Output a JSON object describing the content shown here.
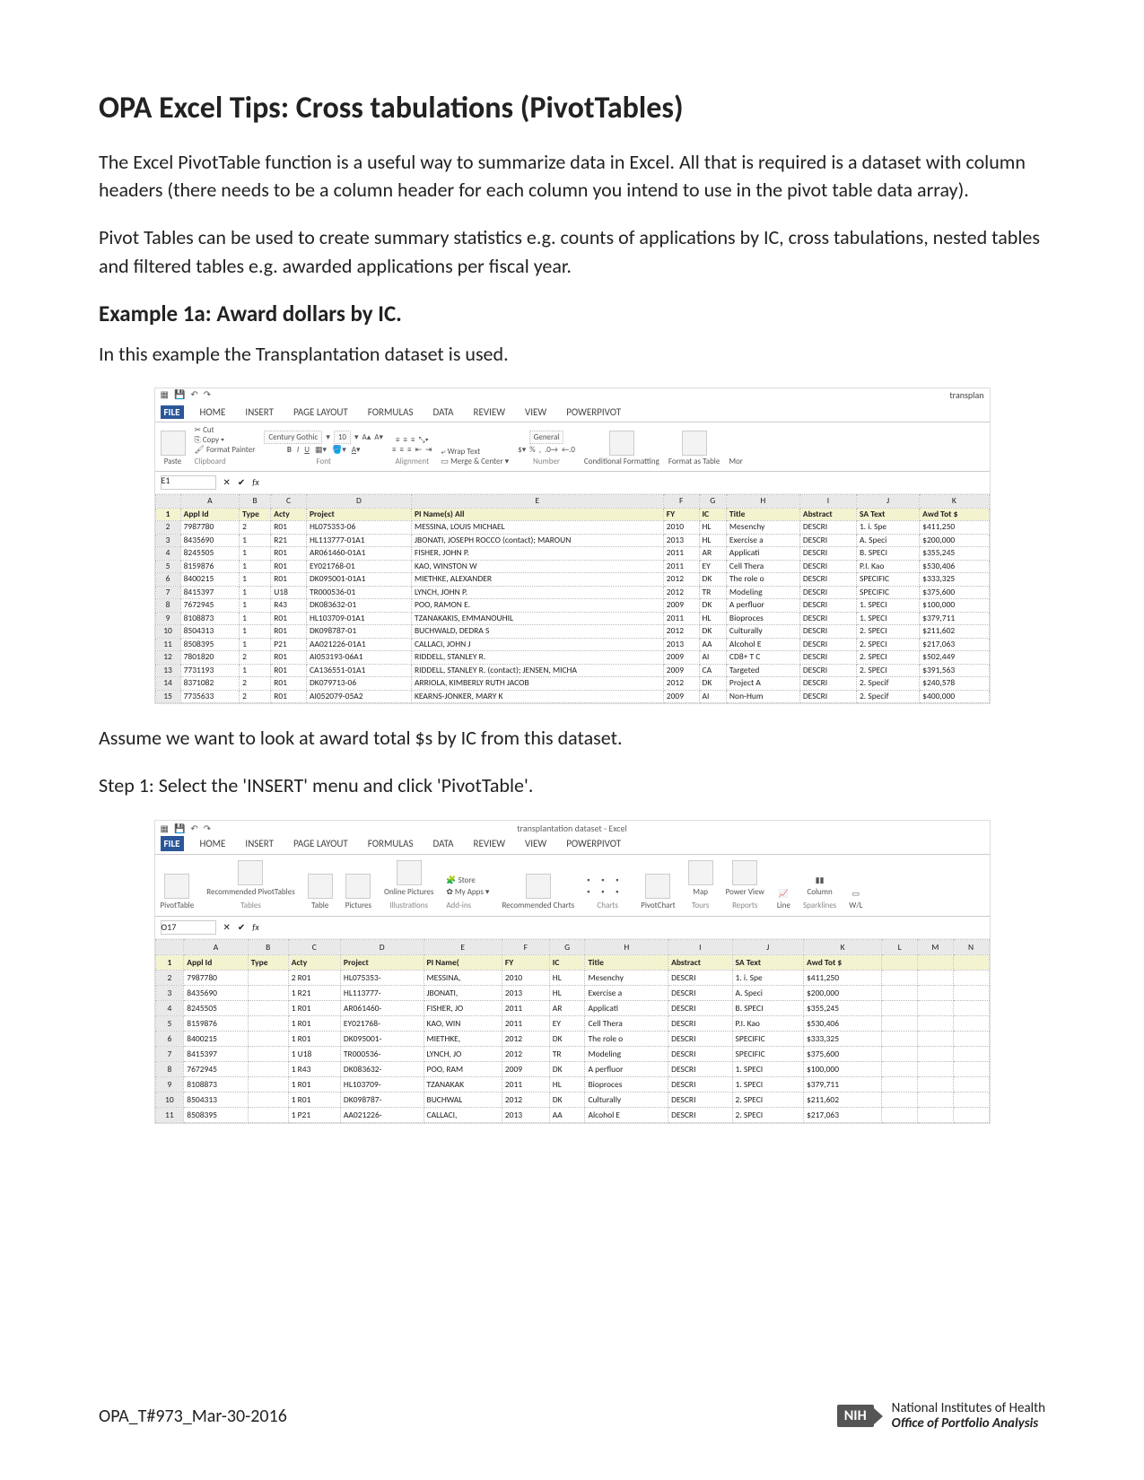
{
  "title": "OPA Excel Tips: Cross tabulations (PivotTables)",
  "para1": "The Excel PivotTable function is a useful way to summarize data in Excel.  All that is required is a dataset with column headers (there needs to be a column header for each column you intend to use in the pivot table data array).",
  "para2": "Pivot Tables can be used to create summary statistics e.g. counts of applications by IC, cross tabulations, nested tables and filtered tables e.g. awarded applications per fiscal year.",
  "example_heading": "Example 1a: Award dollars by IC.",
  "example_intro": "In this example the Transplantation dataset is used.",
  "assume_line": "Assume we want to look at award total $s by IC from this dataset.",
  "step1": "Step 1: Select the 'INSERT' menu and click 'PivotTable'.",
  "footer_id": "OPA_T#973_Mar-30-2016",
  "footer_org1": "National Institutes of Health",
  "footer_org2": "Office of Portfolio Analysis",
  "nih": "NIH",
  "ribbon_tabs": [
    "FILE",
    "HOME",
    "INSERT",
    "PAGE LAYOUT",
    "FORMULAS",
    "DATA",
    "REVIEW",
    "VIEW",
    "POWERPIVOT"
  ],
  "shot1": {
    "titlebar": "transplan",
    "clip": {
      "cut": "Cut",
      "copy": "Copy",
      "fmt": "Format Painter",
      "paste": "Paste",
      "group": "Clipboard"
    },
    "font": {
      "name": "Century Gothic",
      "size": "10",
      "group": "Font"
    },
    "align": {
      "wrap": "Wrap Text",
      "merge": "Merge & Center",
      "group": "Alignment"
    },
    "number": {
      "fmt": "General",
      "group": "Number"
    },
    "styles": {
      "cond": "Conditional Formatting",
      "fmtas": "Format as Table",
      "more": "Mor"
    },
    "cellref": "E1",
    "cols": [
      "",
      "A",
      "B",
      "C",
      "D",
      "E",
      "F",
      "G",
      "H",
      "I",
      "J",
      "K"
    ],
    "header_row": [
      "1",
      "Appl Id",
      "Type",
      "Acty",
      "Project",
      "PI Name(s) All",
      "FY",
      "IC",
      "Title",
      "Abstract",
      "SA Text",
      "Awd Tot $"
    ],
    "rows": [
      [
        "2",
        "7987780",
        "2",
        "R01",
        "HL075353-06",
        "MESSINA, LOUIS MICHAEL",
        "2010",
        "HL",
        "Mesenchy",
        "DESCRI",
        "1. i. Spe",
        "$411,250"
      ],
      [
        "3",
        "8435690",
        "1",
        "R21",
        "HL113777-01A1",
        "JBONATI, JOSEPH ROCCO (contact); MAROUN",
        "2013",
        "HL",
        "Exercise a",
        "DESCRI",
        "A. Speci",
        "$200,000"
      ],
      [
        "4",
        "8245505",
        "1",
        "R01",
        "AR061460-01A1",
        "FISHER, JOHN P.",
        "2011",
        "AR",
        "Applicati",
        "DESCRI",
        "B. SPECI",
        "$355,245"
      ],
      [
        "5",
        "8159876",
        "1",
        "R01",
        "EY021768-01",
        "KAO, WINSTON W",
        "2011",
        "EY",
        "Cell Thera",
        "DESCRI",
        "P.I. Kao",
        "$530,406"
      ],
      [
        "6",
        "8400215",
        "1",
        "R01",
        "DK095001-01A1",
        "MIETHKE, ALEXANDER",
        "2012",
        "DK",
        "The role o",
        "DESCRI",
        "SPECIFIC",
        "$333,325"
      ],
      [
        "7",
        "8415397",
        "1",
        "U18",
        "TR000536-01",
        "LYNCH, JOHN P.",
        "2012",
        "TR",
        "Modeling",
        "DESCRI",
        "SPECIFIC",
        "$375,600"
      ],
      [
        "8",
        "7672945",
        "1",
        "R43",
        "DK083632-01",
        "POO, RAMON E.",
        "2009",
        "DK",
        "A perfluor",
        "DESCRI",
        "1. SPECI",
        "$100,000"
      ],
      [
        "9",
        "8108873",
        "1",
        "R01",
        "HL103709-01A1",
        "TZANAKAKIS, EMMANOUHIL",
        "2011",
        "HL",
        "Bioproces",
        "DESCRI",
        "1. SPECI",
        "$379,711"
      ],
      [
        "10",
        "8504313",
        "1",
        "R01",
        "DK098787-01",
        "BUCHWALD, DEDRA S",
        "2012",
        "DK",
        "Culturally",
        "DESCRI",
        "2. SPECI",
        "$211,602"
      ],
      [
        "11",
        "8508395",
        "1",
        "P21",
        "AA021226-01A1",
        "CALLACI, JOHN J",
        "2013",
        "AA",
        "Alcohol E",
        "DESCRI",
        "2. SPECI",
        "$217,063"
      ],
      [
        "12",
        "7801820",
        "2",
        "R01",
        "AI053193-06A1",
        "RIDDELL, STANLEY R.",
        "2009",
        "AI",
        "CD8+ T C",
        "DESCRI",
        "2. SPECI",
        "$502,449"
      ],
      [
        "13",
        "7731193",
        "1",
        "R01",
        "CA136551-01A1",
        "RIDDELL, STANLEY R. (contact); JENSEN, MICHA",
        "2009",
        "CA",
        "Targeted",
        "DESCRI",
        "2. SPECI",
        "$391,563"
      ],
      [
        "14",
        "8371082",
        "2",
        "R01",
        "DK079713-06",
        "ARRIOLA, KIMBERLY RUTH JACOB",
        "2012",
        "DK",
        "Project A",
        "DESCRI",
        "2. Specif",
        "$240,578"
      ],
      [
        "15",
        "7735633",
        "2",
        "R01",
        "AI052079-05A2",
        "KEARNS-JONKER, MARY K",
        "2009",
        "AI",
        "Non-Hum",
        "DESCRI",
        "2. Specif",
        "$400,000"
      ]
    ]
  },
  "shot2": {
    "titlebar": "transplantation dataset - Excel",
    "insert": {
      "pivot": "PivotTable",
      "recpivot": "Recommended PivotTables",
      "table": "Table",
      "group1": "Tables",
      "pics": "Pictures",
      "online": "Online Pictures",
      "group2": "Illustrations",
      "store": "Store",
      "myapps": "My Apps",
      "group3": "Add-ins",
      "reccharts": "Recommended Charts",
      "group4": "Charts",
      "pivotchart": "PivotChart",
      "map": "Map",
      "power": "Power View",
      "group5": "Tours",
      "line": "Line",
      "col": "Column",
      "wl": "W/L",
      "group6": "Sparklines",
      "reports": "Reports"
    },
    "cellref": "O17",
    "cols": [
      "",
      "A",
      "B",
      "C",
      "D",
      "E",
      "F",
      "G",
      "H",
      "I",
      "J",
      "K",
      "L",
      "M",
      "N"
    ],
    "header_row": [
      "1",
      "Appl Id",
      "Type",
      "Acty",
      "Project",
      "PI Name(",
      "FY",
      "IC",
      "Title",
      "Abstract",
      "SA Text",
      "Awd Tot $",
      "",
      "",
      ""
    ],
    "rows": [
      [
        "2",
        "7987780",
        "",
        "2 R01",
        "HL075353-",
        "MESSINA,",
        "2010",
        "HL",
        "Mesenchy",
        "DESCRI",
        "1. i. Spe",
        "$411,250",
        "",
        "",
        ""
      ],
      [
        "3",
        "8435690",
        "",
        "1 R21",
        "HL113777-",
        "JBONATI,",
        "2013",
        "HL",
        "Exercise a",
        "DESCRI",
        "A. Speci",
        "$200,000",
        "",
        "",
        ""
      ],
      [
        "4",
        "8245505",
        "",
        "1 R01",
        "AR061460-",
        "FISHER, JO",
        "2011",
        "AR",
        "Applicati",
        "DESCRI",
        "B. SPECI",
        "$355,245",
        "",
        "",
        ""
      ],
      [
        "5",
        "8159876",
        "",
        "1 R01",
        "EY021768-",
        "KAO, WIN",
        "2011",
        "EY",
        "Cell Thera",
        "DESCRI",
        "P.I. Kao",
        "$530,406",
        "",
        "",
        ""
      ],
      [
        "6",
        "8400215",
        "",
        "1 R01",
        "DK095001-",
        "MIETHKE,",
        "2012",
        "DK",
        "The role o",
        "DESCRI",
        "SPECIFIC",
        "$333,325",
        "",
        "",
        ""
      ],
      [
        "7",
        "8415397",
        "",
        "1 U18",
        "TR000536-",
        "LYNCH, JO",
        "2012",
        "TR",
        "Modeling",
        "DESCRI",
        "SPECIFIC",
        "$375,600",
        "",
        "",
        ""
      ],
      [
        "8",
        "7672945",
        "",
        "1 R43",
        "DK083632-",
        "POO, RAM",
        "2009",
        "DK",
        "A perfluor",
        "DESCRI",
        "1. SPECI",
        "$100,000",
        "",
        "",
        ""
      ],
      [
        "9",
        "8108873",
        "",
        "1 R01",
        "HL103709-",
        "TZANAKAK",
        "2011",
        "HL",
        "Bioproces",
        "DESCRI",
        "1. SPECI",
        "$379,711",
        "",
        "",
        ""
      ],
      [
        "10",
        "8504313",
        "",
        "1 R01",
        "DK098787-",
        "BUCHWAL",
        "2012",
        "DK",
        "Culturally",
        "DESCRI",
        "2. SPECI",
        "$211,602",
        "",
        "",
        ""
      ],
      [
        "11",
        "8508395",
        "",
        "1 P21",
        "AA021226-",
        "CALLACI,",
        "2013",
        "AA",
        "Alcohol E",
        "DESCRI",
        "2. SPECI",
        "$217,063",
        "",
        "",
        ""
      ]
    ]
  }
}
